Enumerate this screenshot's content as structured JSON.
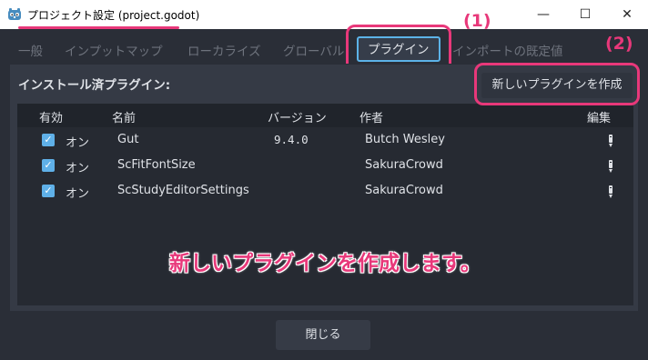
{
  "window": {
    "title": "プロジェクト設定 (project.godot)",
    "minimize_glyph": "—",
    "maximize_glyph": "☐",
    "close_glyph": "✕",
    "accent_color": "#e8387a"
  },
  "tabs": [
    {
      "label": "一般"
    },
    {
      "label": "インプットマップ"
    },
    {
      "label": "ローカライズ"
    },
    {
      "label": "グローバル"
    },
    {
      "label": "プラグイン",
      "active": true
    },
    {
      "label": "インポートの既定値"
    }
  ],
  "callouts": {
    "one": "(1)",
    "two": "(2)"
  },
  "panel": {
    "title": "インストール済プラグイン:",
    "create_button": "新しいプラグインを作成"
  },
  "table": {
    "headers": {
      "enabled": "有効",
      "name": "名前",
      "version": "バージョン",
      "author": "作者",
      "edit": "編集"
    },
    "rows": [
      {
        "checked": true,
        "status": "オン",
        "name": "Gut",
        "version": "9.4.0",
        "author": "Butch Wesley"
      },
      {
        "checked": true,
        "status": "オン",
        "name": "ScFitFontSize",
        "version": "",
        "author": "SakuraCrowd"
      },
      {
        "checked": true,
        "status": "オン",
        "name": "ScStudyEditorSettings",
        "version": "",
        "author": "SakuraCrowd"
      }
    ]
  },
  "overlay_text": "新しいプラグインを作成します。",
  "footer": {
    "close_button": "閉じる"
  }
}
